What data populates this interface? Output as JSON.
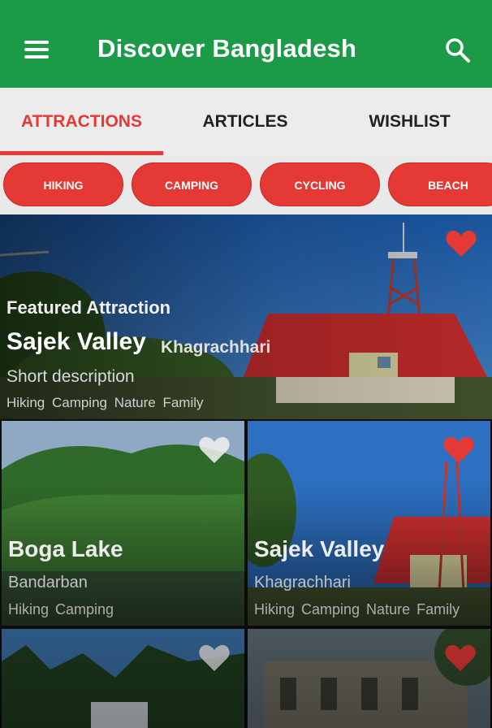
{
  "appbar": {
    "title": "Discover Bangladesh",
    "menu_icon": "menu-icon",
    "search_icon": "search-icon",
    "color": "#1b9a47"
  },
  "tabs": [
    {
      "label": "ATTRACTIONS",
      "active": true
    },
    {
      "label": "ARTICLES",
      "active": false
    },
    {
      "label": "WISHLIST",
      "active": false
    }
  ],
  "accent_color": "#e53935",
  "chips": [
    "HIKING",
    "CAMPING",
    "CYCLING",
    "BEACH"
  ],
  "featured": {
    "label": "Featured Attraction",
    "name": "Sajek Valley",
    "location": "Khagrachhari",
    "description": "Short description",
    "tags": "Hiking Camping Nature Family",
    "favorite": true
  },
  "cards": [
    {
      "name": "Boga Lake",
      "location": "Bandarban",
      "tags": "Hiking Camping",
      "favorite": false
    },
    {
      "name": "Sajek Valley",
      "location": "Khagrachhari",
      "tags": "Hiking Camping Nature Family",
      "favorite": true
    },
    {
      "name": "",
      "location": "",
      "tags": "",
      "favorite": false
    },
    {
      "name": "",
      "location": "",
      "tags": "",
      "favorite": true
    }
  ]
}
